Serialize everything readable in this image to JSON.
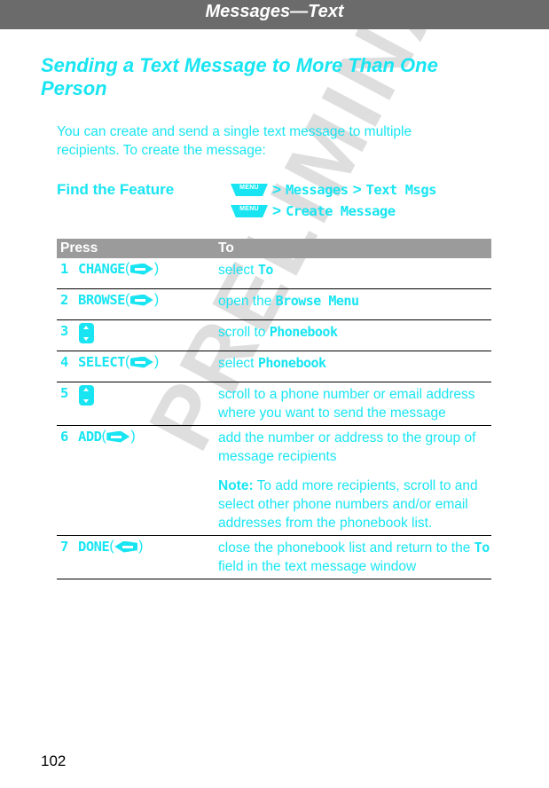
{
  "header": {
    "title": "Messages—Text"
  },
  "section": {
    "title": "Sending a Text Message to More Than One Person",
    "intro": "You can create and send a single text message to multiple recipients. To create the message:"
  },
  "find_feature": {
    "label": "Find the Feature",
    "menu_key_label": "MENU",
    "separator": ">",
    "paths": [
      {
        "items": [
          "Messages",
          "Text Msgs"
        ]
      },
      {
        "items": [
          "Create Message"
        ]
      }
    ]
  },
  "steps_table": {
    "columns": [
      "Press",
      "To"
    ],
    "rows": [
      {
        "num": "1",
        "press_label": "CHANGE",
        "key_icon": "right-softkey-icon",
        "to_parts": [
          {
            "text": "select ",
            "style": "normal"
          },
          {
            "text": "To",
            "style": "mono"
          }
        ]
      },
      {
        "num": "2",
        "press_label": "BROWSE",
        "key_icon": "right-softkey-icon",
        "to_parts": [
          {
            "text": "open the ",
            "style": "normal"
          },
          {
            "text": "Browse Menu",
            "style": "mono"
          }
        ]
      },
      {
        "num": "3",
        "press_label": "",
        "key_icon": "scroll-key-icon",
        "to_parts": [
          {
            "text": "scroll to ",
            "style": "normal"
          },
          {
            "text": "Phonebook",
            "style": "mono"
          }
        ]
      },
      {
        "num": "4",
        "press_label": "SELECT",
        "key_icon": "right-softkey-icon",
        "to_parts": [
          {
            "text": "select ",
            "style": "normal"
          },
          {
            "text": "Phonebook",
            "style": "mono"
          }
        ]
      },
      {
        "num": "5",
        "press_label": "",
        "key_icon": "scroll-key-icon",
        "to_parts": [
          {
            "text": "scroll to a phone number or email address where you want to send the message",
            "style": "normal"
          }
        ]
      },
      {
        "num": "6",
        "press_label": "ADD",
        "key_icon": "right-softkey-icon",
        "to_parts": [
          {
            "text": "add the number or address to the group of message recipients",
            "style": "normal"
          }
        ],
        "note": {
          "label": "Note:",
          "text": " To add more recipients, scroll to and select other phone numbers and/or email addresses from the phonebook list."
        }
      },
      {
        "num": "7",
        "press_label": "DONE",
        "key_icon": "left-softkey-icon",
        "to_parts": [
          {
            "text": "close the phonebook list and return to the ",
            "style": "normal"
          },
          {
            "text": "To",
            "style": "mono"
          },
          {
            "text": " field in the text message window",
            "style": "normal"
          }
        ]
      }
    ]
  },
  "watermark": {
    "text": "PRELIMINARY"
  },
  "footer": {
    "page_number": "102"
  },
  "colors": {
    "accent_cyan": "#19e5f2",
    "header_bar_gray": "#6b6b6b",
    "table_head_gray": "#9b9b9b",
    "watermark_gray": "#dedede"
  }
}
